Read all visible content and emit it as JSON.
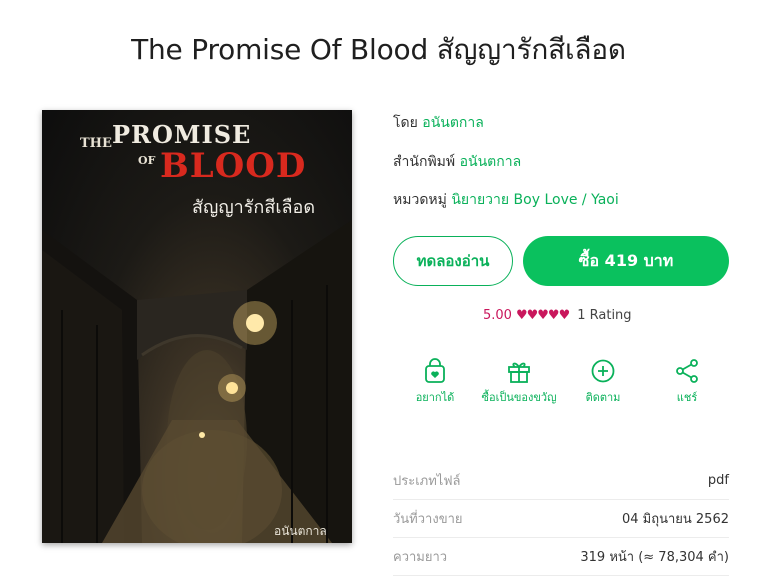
{
  "book": {
    "title": "The Promise Of Blood สัญญารักสีเลือด"
  },
  "cover": {
    "the": "THE",
    "promise": "PROMISE",
    "of": "OF",
    "blood": "BLOOD",
    "thai_title": "สัญญารักสีเลือด",
    "author": "อนันตกาล"
  },
  "meta": {
    "author_label": "โดย",
    "author_value": "อนันตกาล",
    "publisher_label": "สำนักพิมพ์",
    "publisher_value": "อนันตกาล",
    "category_label": "หมวดหมู่",
    "category_value": "นิยายวาย Boy Love / Yaoi"
  },
  "buttons": {
    "try_read": "ทดลองอ่าน",
    "buy": "ซื้อ 419 บาท"
  },
  "rating": {
    "score": "5.00",
    "hearts": "♥♥♥♥♥",
    "stars_value": 5,
    "count_text": "1 Rating"
  },
  "actions": [
    {
      "label": "อยากได้",
      "icon": "wishlist-bag-icon"
    },
    {
      "label": "ซื้อเป็นของขวัญ",
      "icon": "gift-icon"
    },
    {
      "label": "ติดตาม",
      "icon": "plus-circle-icon"
    },
    {
      "label": "แชร์",
      "icon": "share-icon"
    }
  ],
  "details": [
    {
      "label": "ประเภทไฟล์",
      "value": "pdf"
    },
    {
      "label": "วันที่วางขาย",
      "value": "04 มิถุนายน 2562"
    },
    {
      "label": "ความยาว",
      "value": "319 หน้า (≈ 78,304 คำ)"
    }
  ],
  "colors": {
    "accent": "#0ab15a",
    "buy_button": "#0ac15e",
    "rating": "#c9175c",
    "blood_red": "#d8291e"
  }
}
